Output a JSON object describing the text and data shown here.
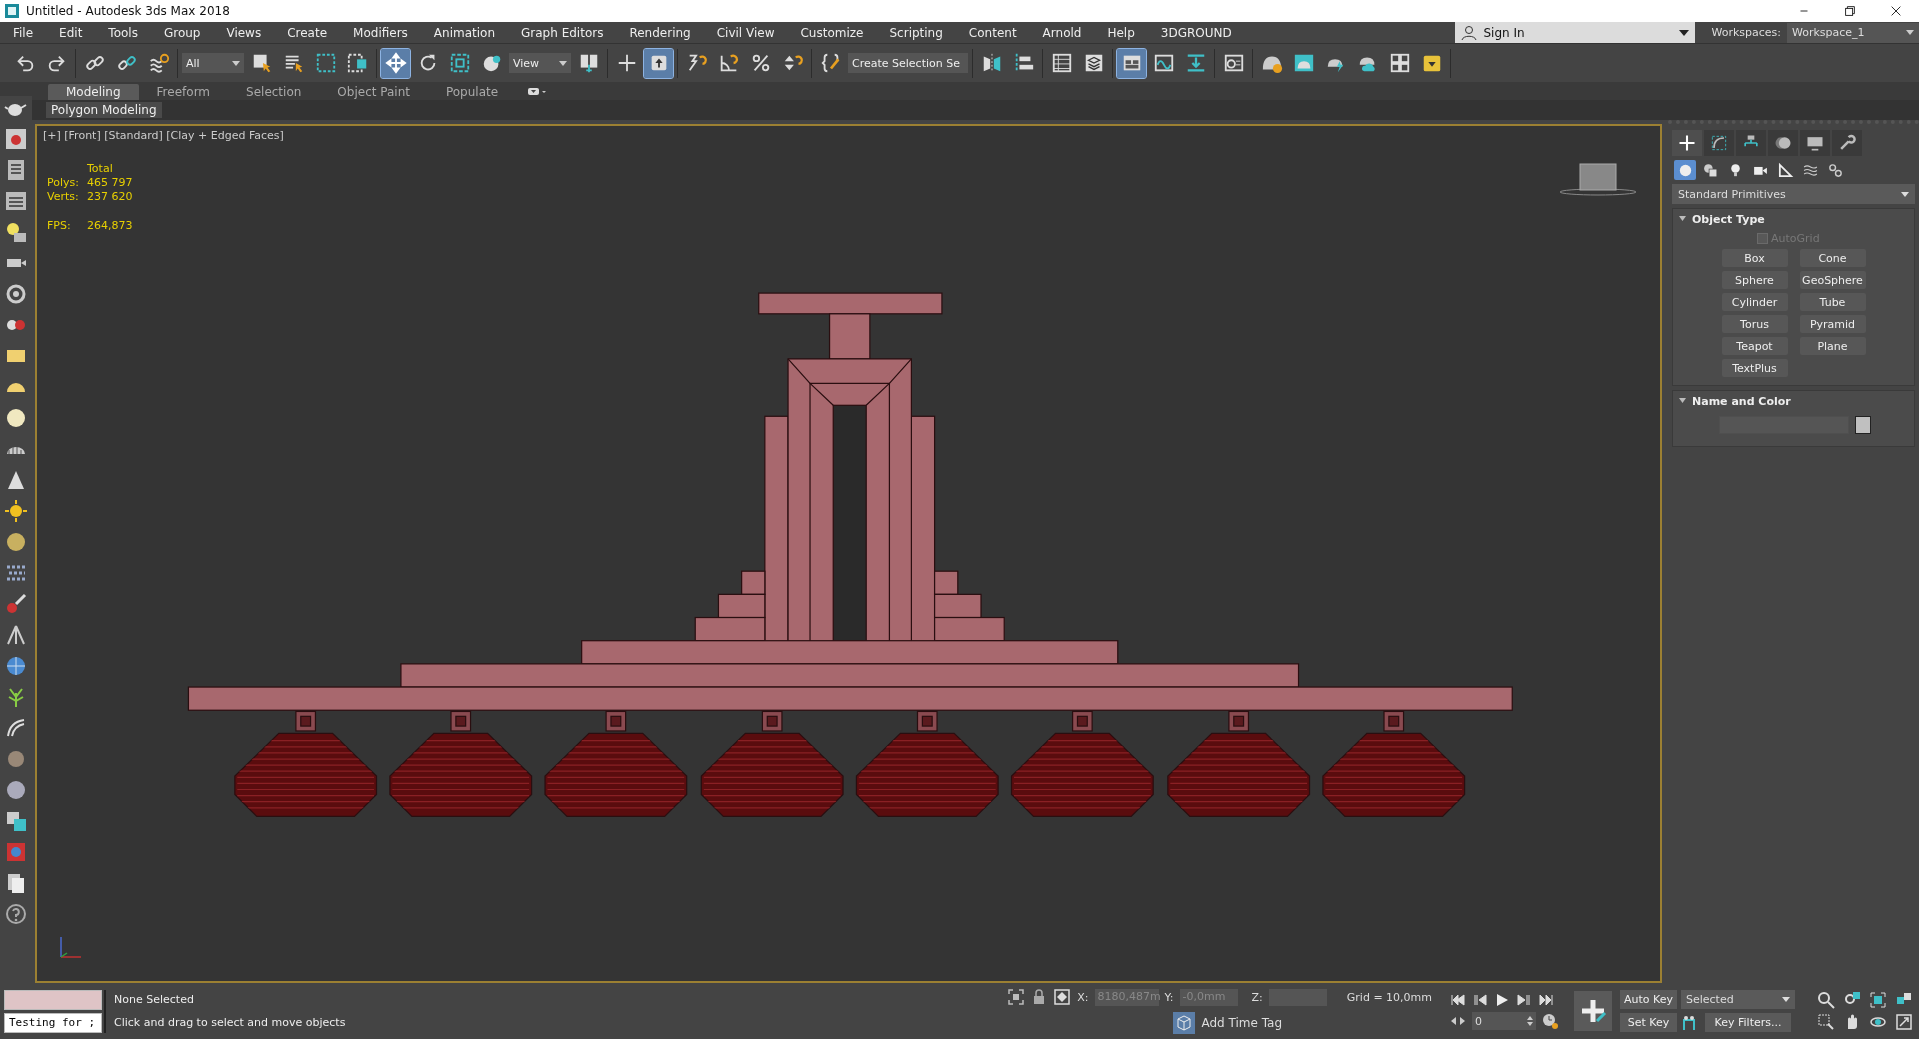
{
  "window": {
    "title": "Untitled - Autodesk 3ds Max 2018"
  },
  "menu": [
    "File",
    "Edit",
    "Tools",
    "Group",
    "Views",
    "Create",
    "Modifiers",
    "Animation",
    "Graph Editors",
    "Rendering",
    "Civil View",
    "Customize",
    "Scripting",
    "Content",
    "Arnold",
    "Help",
    "3DGROUND"
  ],
  "account": {
    "sign_in": "Sign In",
    "workspaces_label": "Workspaces:",
    "workspace": "Workspace_1"
  },
  "main_toolbar": [
    [
      {
        "kind": "icon",
        "selected": false
      },
      {
        "kind": "icon",
        "selected": false
      }
    ],
    [
      {
        "kind": "icon",
        "selected": false
      },
      {
        "kind": "icon",
        "selected": false
      },
      {
        "kind": "icon",
        "selected": false
      }
    ],
    [
      {
        "kind": "dropdown",
        "label": "All"
      },
      {
        "kind": "icon",
        "selected": false
      },
      {
        "kind": "icon",
        "selected": false
      },
      {
        "kind": "icon",
        "selected": false
      },
      {
        "kind": "icon",
        "selected": false
      }
    ],
    [
      {
        "kind": "icon",
        "selected": true
      },
      {
        "kind": "icon",
        "selected": false
      },
      {
        "kind": "icon",
        "selected": false
      },
      {
        "kind": "icon",
        "selected": false
      },
      {
        "kind": "dropdown",
        "label": "View"
      },
      {
        "kind": "icon",
        "selected": false
      }
    ],
    [
      {
        "kind": "icon",
        "selected": false
      },
      {
        "kind": "icon",
        "selected": true
      }
    ],
    [
      {
        "kind": "icon",
        "selected": false
      },
      {
        "kind": "icon",
        "selected": false
      },
      {
        "kind": "icon",
        "selected": false
      },
      {
        "kind": "icon",
        "selected": false
      }
    ],
    [
      {
        "kind": "icon",
        "selected": false
      },
      {
        "kind": "dropdown",
        "label": "Create Selection Se"
      }
    ],
    [
      {
        "kind": "icon",
        "selected": false
      },
      {
        "kind": "icon",
        "selected": false
      }
    ],
    [
      {
        "kind": "icon",
        "selected": false
      },
      {
        "kind": "icon",
        "selected": false
      }
    ],
    [
      {
        "kind": "icon",
        "selected": true
      },
      {
        "kind": "icon",
        "selected": false
      },
      {
        "kind": "icon",
        "selected": false
      }
    ],
    [
      {
        "kind": "icon",
        "selected": false
      }
    ],
    [
      {
        "kind": "icon",
        "selected": false
      },
      {
        "kind": "icon",
        "selected": false
      },
      {
        "kind": "icon",
        "selected": false
      },
      {
        "kind": "icon",
        "selected": false
      },
      {
        "kind": "icon",
        "selected": false
      },
      {
        "kind": "icon",
        "selected": false
      }
    ]
  ],
  "ribbon": {
    "tabs": [
      {
        "label": "Modeling",
        "selected": true
      },
      {
        "label": "Freeform",
        "selected": false
      },
      {
        "label": "Selection",
        "selected": false
      },
      {
        "label": "Object Paint",
        "selected": false
      },
      {
        "label": "Populate",
        "selected": false
      }
    ],
    "panel": "Polygon Modeling"
  },
  "viewport": {
    "label": "[+] [Front] [Standard] [Clay + Edged Faces]",
    "stats": {
      "header": "Total",
      "rows": [
        {
          "label": "Polys:",
          "value": "465 797"
        },
        {
          "label": "Verts:",
          "value": "237 620"
        }
      ],
      "fps_label": "FPS:",
      "fps": "264,873"
    }
  },
  "command_panel": {
    "tabs": [
      {
        "selected": true
      },
      {
        "selected": false
      },
      {
        "selected": false
      },
      {
        "selected": false
      },
      {
        "selected": false
      },
      {
        "selected": false
      }
    ],
    "categories": [
      {
        "selected": true
      },
      {
        "selected": false
      },
      {
        "selected": false
      },
      {
        "selected": false
      },
      {
        "selected": false
      },
      {
        "selected": false
      },
      {
        "selected": false
      }
    ],
    "dropdown": "Standard Primitives",
    "rollouts": [
      {
        "title": "Object Type",
        "expanded": true,
        "autogrid": {
          "label": "AutoGrid",
          "checked": false,
          "disabled": true
        },
        "buttons": [
          "Box",
          "Cone",
          "Sphere",
          "GeoSphere",
          "Cylinder",
          "Tube",
          "Torus",
          "Pyramid",
          "Teapot",
          "Plane",
          "TextPlus"
        ]
      },
      {
        "title": "Name and Color",
        "expanded": true
      }
    ]
  },
  "status": {
    "listener": "Testing for ;",
    "selection": "None Selected",
    "prompt": "Click and drag to select and move objects",
    "x_label": "X:",
    "x": "8180,487m",
    "y_label": "Y:",
    "y": "-0,0mm",
    "z_label": "Z:",
    "grid": "Grid = 10,0mm",
    "time_tag": "Add Time Tag",
    "frame": "0",
    "auto_key": "Auto Key",
    "key_set": "Selected",
    "set_key": "Set Key",
    "key_filters": "Key Filters..."
  }
}
